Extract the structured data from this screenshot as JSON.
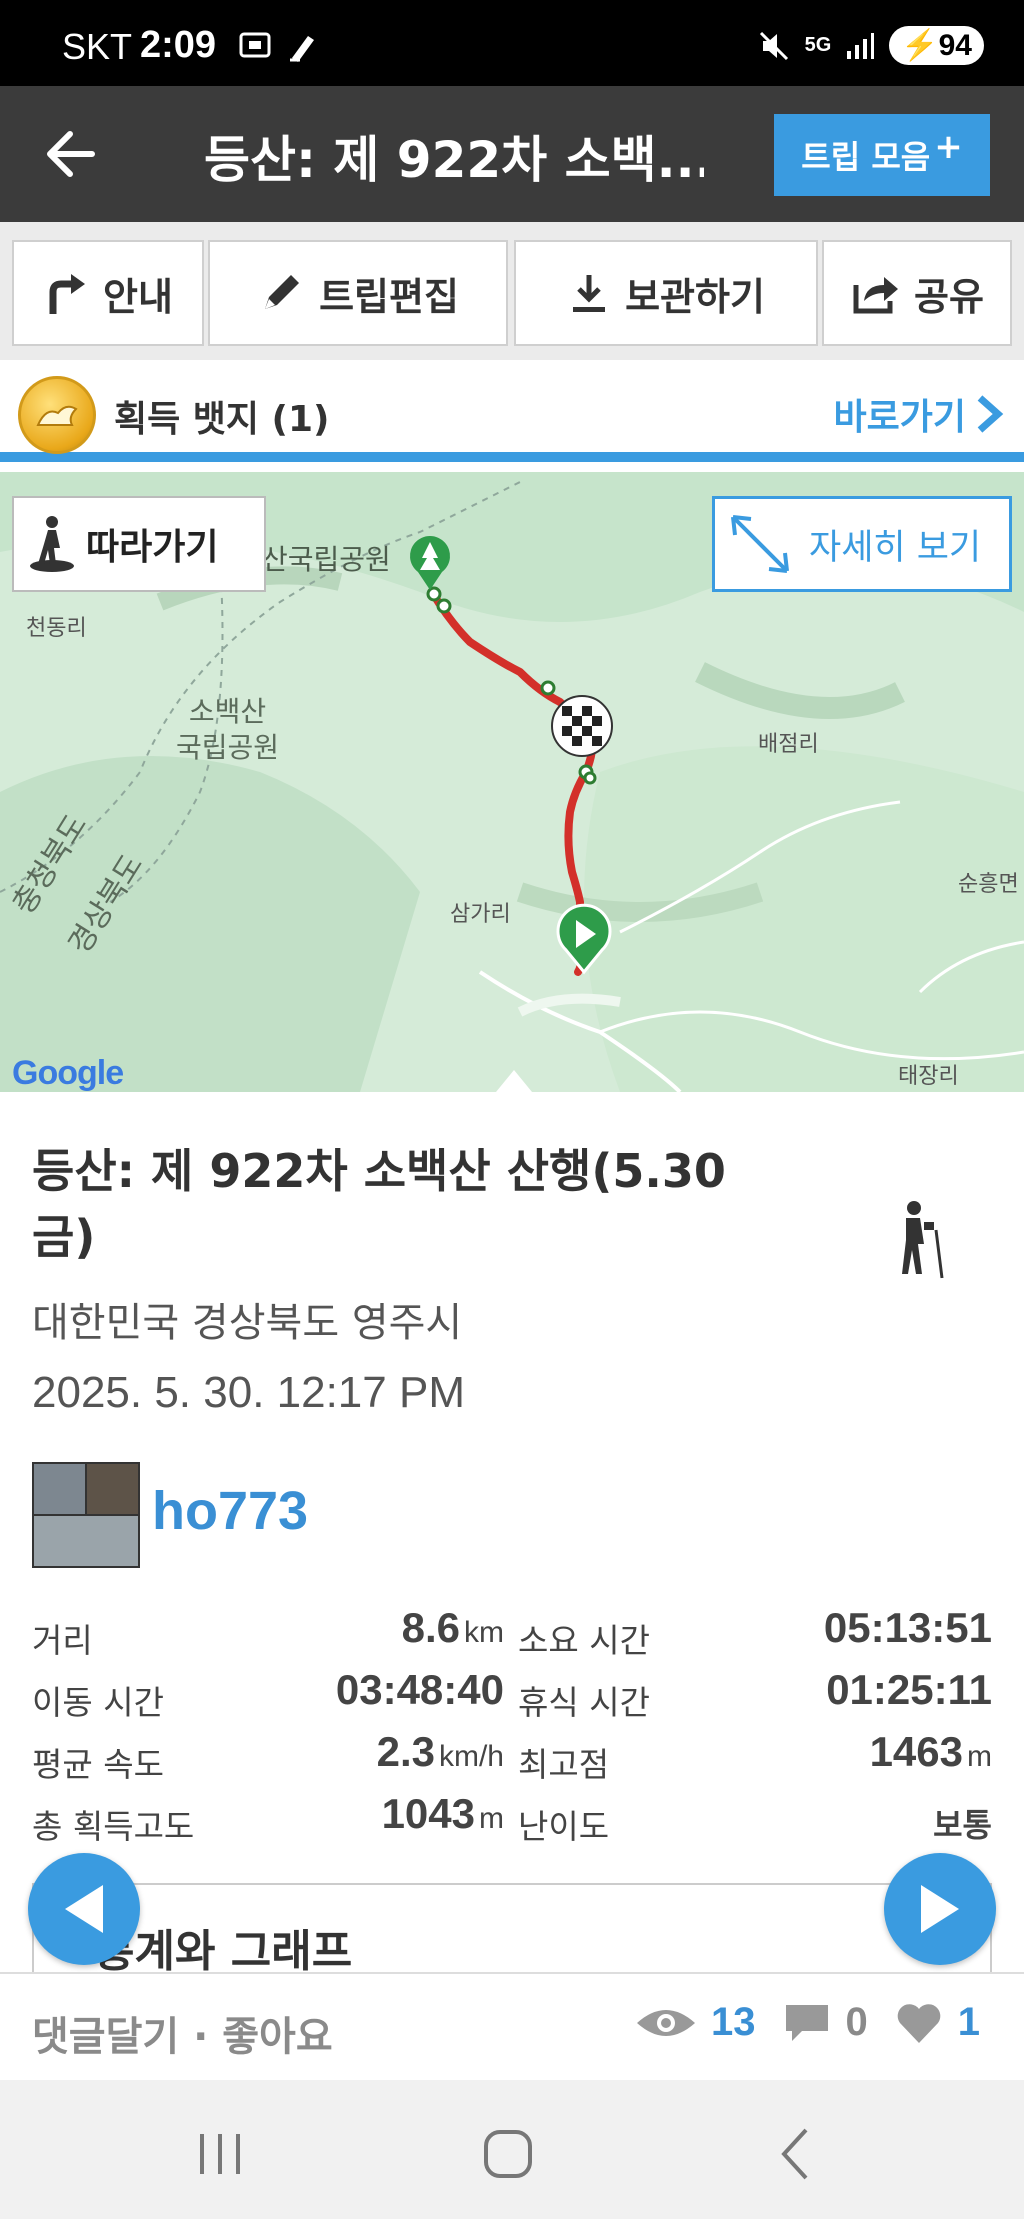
{
  "status_bar": {
    "carrier": "SKT",
    "time": "2:09",
    "network": "5G",
    "battery": "94"
  },
  "header": {
    "title": "등산: 제 922차 소백...",
    "trip_collection_label": "트립 모음"
  },
  "actions": {
    "guide": "안내",
    "edit": "트립편집",
    "save": "보관하기",
    "share": "공유"
  },
  "badge": {
    "label": "획득 뱃지 (1)",
    "shortcut": "바로가기"
  },
  "map": {
    "follow": "따라가기",
    "detail": "자세히 보기",
    "labels": {
      "park_name": "산국립공원",
      "cheondong": "천동리",
      "sobaeksan_park": "소백산\n국립공원",
      "baejeom": "배점리",
      "samgari": "삼가리",
      "sunheung": "순흥면",
      "chungbuk": "충청북도",
      "gyeongbuk": "경상북도",
      "taejang": "태장리"
    },
    "attribution": "Google",
    "route_color": "#d3302a"
  },
  "trip": {
    "title": "등산: 제 922차 소백산 산행(5.30 금)",
    "location": "대한민국 경상북도 영주시",
    "datetime": "2025. 5. 30. 12:17 PM",
    "username": "ho773"
  },
  "stats": {
    "distance_label": "거리",
    "distance_value": "8.6",
    "distance_unit": "km",
    "duration_label": "소요 시간",
    "duration_value": "05:13:51",
    "moving_label": "이동 시간",
    "moving_value": "03:48:40",
    "rest_label": "휴식 시간",
    "rest_value": "01:25:11",
    "speed_label": "평균 속도",
    "speed_value": "2.3",
    "speed_unit": "km/h",
    "peak_label": "최고점",
    "peak_value": "1463",
    "peak_unit": "m",
    "gain_label": "총 획득고도",
    "gain_value": "1043",
    "gain_unit": "m",
    "difficulty_label": "난이도",
    "difficulty_value": "보통"
  },
  "graph_section": {
    "title": "통계와 그래프"
  },
  "comment_bar": {
    "comment_like": "댓글달기 · 좋아요",
    "views": "13",
    "comments": "0",
    "likes": "1"
  },
  "colors": {
    "accent": "#3a9be0",
    "header_bg": "#3b3b3b"
  }
}
